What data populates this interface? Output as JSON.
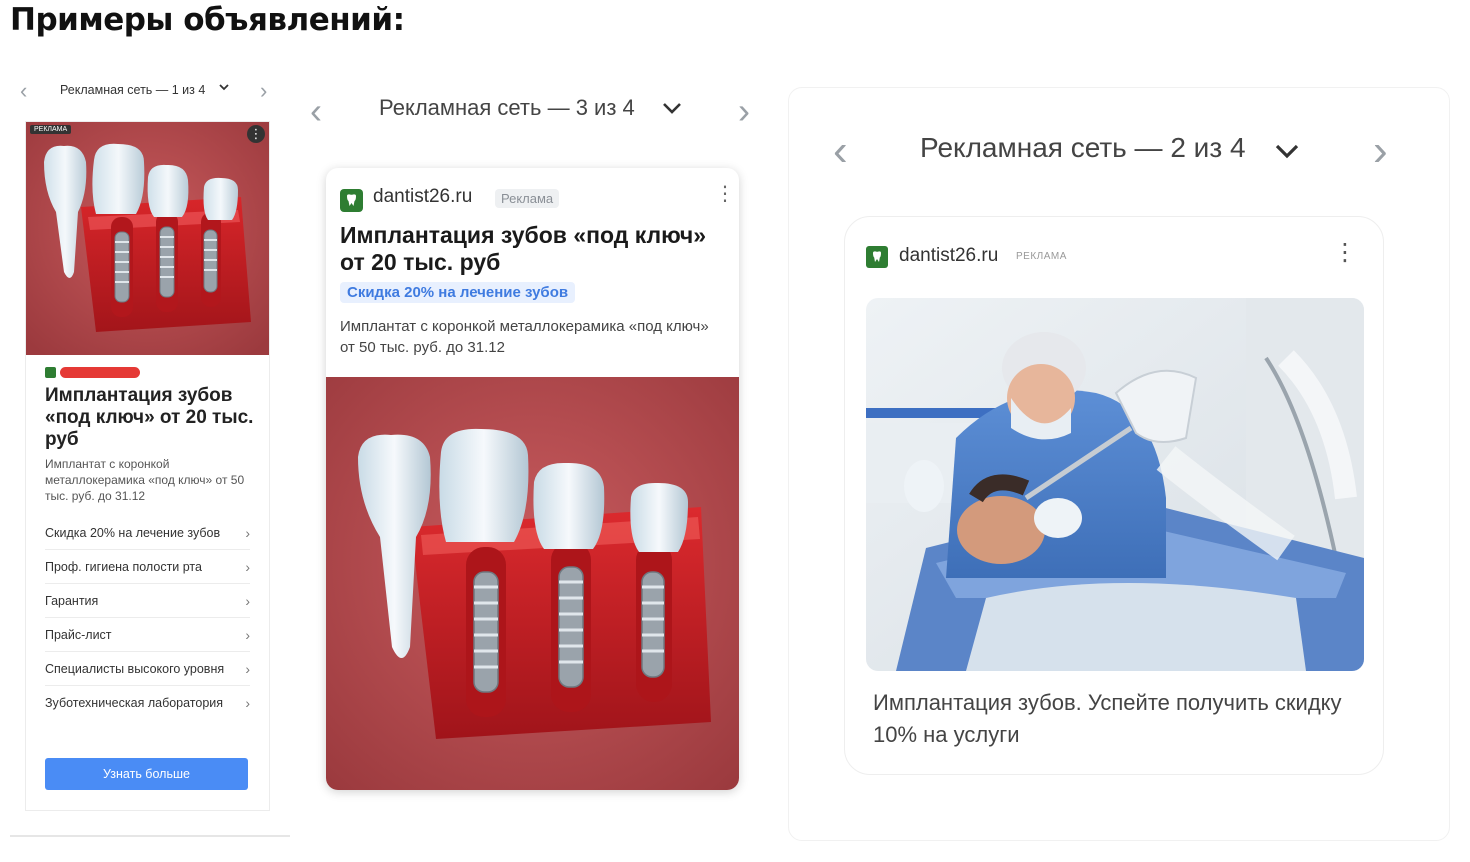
{
  "page": {
    "title": "Примеры объявлений:"
  },
  "panel1": {
    "nav": {
      "prev": "‹",
      "label": "Рекламная сеть — 1 из 4",
      "dropdown": "⌄",
      "next": "›"
    },
    "ad_tag": "РЕКЛАМА",
    "title": "Имплантация зубов «под ключ» от 20 тыс. руб",
    "description": "Имплантат с коронкой металлокерамика «под ключ» от 50 тыс. руб. до 31.12",
    "links": [
      "Скидка 20% на лечение зубов",
      "Проф. гигиена полости рта",
      "Гарантия",
      "Прайс-лист",
      "Специалисты высокого уровня",
      "Зуботехническая лаборатория"
    ],
    "button": "Узнать больше"
  },
  "panel2": {
    "nav": {
      "prev": "‹",
      "label": "Рекламная сеть — 3 из 4",
      "dropdown": "⌄",
      "next": "›"
    },
    "domain": "dantist26.ru",
    "badge": "Реклама",
    "title": "Имплантация зубов «под ключ» от 20 тыс. руб",
    "promo": "Скидка 20% на лечение зубов",
    "description": "Имплантат с коронкой металлокерамика «под ключ» от 50 тыс. руб. до 31.12"
  },
  "panel3": {
    "nav": {
      "prev": "‹",
      "label": "Рекламная сеть — 2 из 4",
      "dropdown": "⌄",
      "next": "›"
    },
    "domain": "dantist26.ru",
    "badge": "РЕКЛАМА",
    "text": "Имплантация зубов. Успейте получить скидку 10% на услуги"
  },
  "colors": {
    "button": "#4a8cf5",
    "promo": "#3f7be0",
    "favicon": "#2e7d32",
    "image_bg": "#b4484c"
  },
  "icons": {
    "chevron_left": "chevron-left-icon",
    "chevron_right": "chevron-right-icon",
    "dropdown": "chevron-down-icon",
    "kebab": "more-vertical-icon",
    "favicon": "tooth-favicon-icon"
  }
}
